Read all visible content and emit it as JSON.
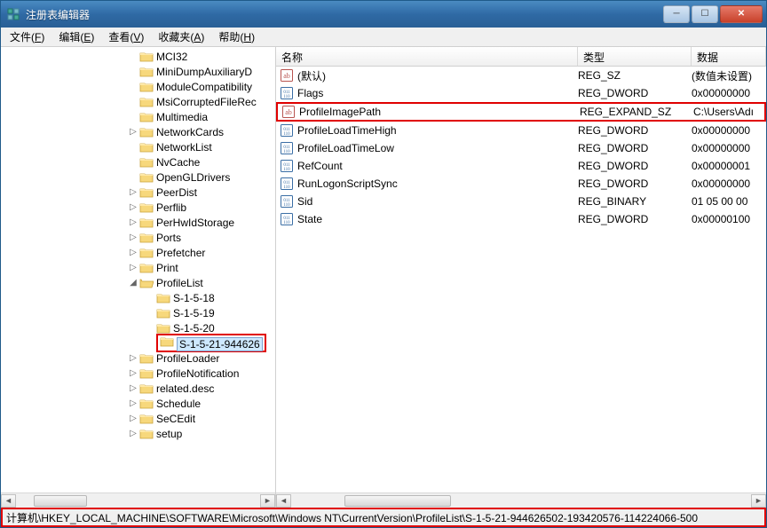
{
  "window": {
    "title": "注册表编辑器"
  },
  "menubar": [
    {
      "label": "文件",
      "accel": "F"
    },
    {
      "label": "编辑",
      "accel": "E"
    },
    {
      "label": "查看",
      "accel": "V"
    },
    {
      "label": "收藏夹",
      "accel": "A"
    },
    {
      "label": "帮助",
      "accel": "H"
    }
  ],
  "tree": {
    "items": [
      {
        "indent": 143,
        "toggle": "",
        "label": "MCI32"
      },
      {
        "indent": 143,
        "toggle": "",
        "label": "MiniDumpAuxiliaryD"
      },
      {
        "indent": 143,
        "toggle": "",
        "label": "ModuleCompatibility"
      },
      {
        "indent": 143,
        "toggle": "",
        "label": "MsiCorruptedFileRec"
      },
      {
        "indent": 143,
        "toggle": "",
        "label": "Multimedia"
      },
      {
        "indent": 143,
        "toggle": "▷",
        "label": "NetworkCards"
      },
      {
        "indent": 143,
        "toggle": "",
        "label": "NetworkList"
      },
      {
        "indent": 143,
        "toggle": "",
        "label": "NvCache"
      },
      {
        "indent": 143,
        "toggle": "",
        "label": "OpenGLDrivers"
      },
      {
        "indent": 143,
        "toggle": "▷",
        "label": "PeerDist"
      },
      {
        "indent": 143,
        "toggle": "▷",
        "label": "Perflib"
      },
      {
        "indent": 143,
        "toggle": "▷",
        "label": "PerHwIdStorage"
      },
      {
        "indent": 143,
        "toggle": "▷",
        "label": "Ports"
      },
      {
        "indent": 143,
        "toggle": "▷",
        "label": "Prefetcher"
      },
      {
        "indent": 143,
        "toggle": "▷",
        "label": "Print"
      },
      {
        "indent": 143,
        "toggle": "◢",
        "label": "ProfileList",
        "open": true
      },
      {
        "indent": 162,
        "toggle": "",
        "label": "S-1-5-18"
      },
      {
        "indent": 162,
        "toggle": "",
        "label": "S-1-5-19"
      },
      {
        "indent": 162,
        "toggle": "",
        "label": "S-1-5-20"
      },
      {
        "indent": 162,
        "toggle": "",
        "label": "S-1-5-21-944626",
        "selected": true,
        "highlight": true
      },
      {
        "indent": 143,
        "toggle": "▷",
        "label": "ProfileLoader"
      },
      {
        "indent": 143,
        "toggle": "▷",
        "label": "ProfileNotification"
      },
      {
        "indent": 143,
        "toggle": "▷",
        "label": "related.desc"
      },
      {
        "indent": 143,
        "toggle": "▷",
        "label": "Schedule"
      },
      {
        "indent": 143,
        "toggle": "▷",
        "label": "SeCEdit"
      },
      {
        "indent": 143,
        "toggle": "▷",
        "label": "setup"
      }
    ]
  },
  "list": {
    "headers": {
      "name": "名称",
      "type": "类型",
      "data": "数据"
    },
    "rows": [
      {
        "icon": "str",
        "name": "(默认)",
        "type": "REG_SZ",
        "data": "(数值未设置)"
      },
      {
        "icon": "bin",
        "name": "Flags",
        "type": "REG_DWORD",
        "data": "0x00000000"
      },
      {
        "icon": "str",
        "name": "ProfileImagePath",
        "type": "REG_EXPAND_SZ",
        "data": "C:\\Users\\Adı",
        "highlight": true
      },
      {
        "icon": "bin",
        "name": "ProfileLoadTimeHigh",
        "type": "REG_DWORD",
        "data": "0x00000000"
      },
      {
        "icon": "bin",
        "name": "ProfileLoadTimeLow",
        "type": "REG_DWORD",
        "data": "0x00000000"
      },
      {
        "icon": "bin",
        "name": "RefCount",
        "type": "REG_DWORD",
        "data": "0x00000001"
      },
      {
        "icon": "bin",
        "name": "RunLogonScriptSync",
        "type": "REG_DWORD",
        "data": "0x00000000"
      },
      {
        "icon": "bin",
        "name": "Sid",
        "type": "REG_BINARY",
        "data": "01 05 00 00"
      },
      {
        "icon": "bin",
        "name": "State",
        "type": "REG_DWORD",
        "data": "0x00000100"
      }
    ]
  },
  "statusbar": {
    "text": "计算机\\HKEY_LOCAL_MACHINE\\SOFTWARE\\Microsoft\\Windows NT\\CurrentVersion\\ProfileList\\S-1-5-21-944626502-193420576-114224066-500"
  }
}
